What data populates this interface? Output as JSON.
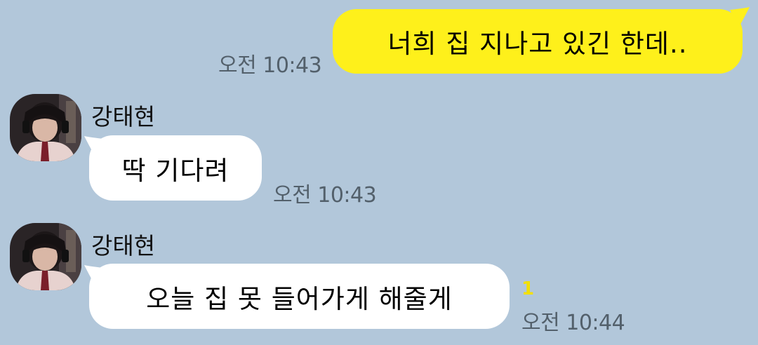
{
  "messages": [
    {
      "direction": "outgoing",
      "text": "너희 집 지나고 있긴 한데..",
      "time": "오전 10:43"
    },
    {
      "direction": "incoming",
      "sender": "강태현",
      "text": "딱 기다려",
      "time": "오전 10:43"
    },
    {
      "direction": "incoming",
      "sender": "강태현",
      "text": "오늘 집 못 들어가게 해줄게",
      "time": "오전 10:44",
      "unread_count": "1"
    }
  ],
  "colors": {
    "background": "#b2c7da",
    "outgoing_bubble": "#fef01b",
    "incoming_bubble": "#ffffff",
    "time_text": "#53606b",
    "unread_badge": "#f2e000"
  },
  "icons": {
    "avatar": "profile-photo"
  }
}
